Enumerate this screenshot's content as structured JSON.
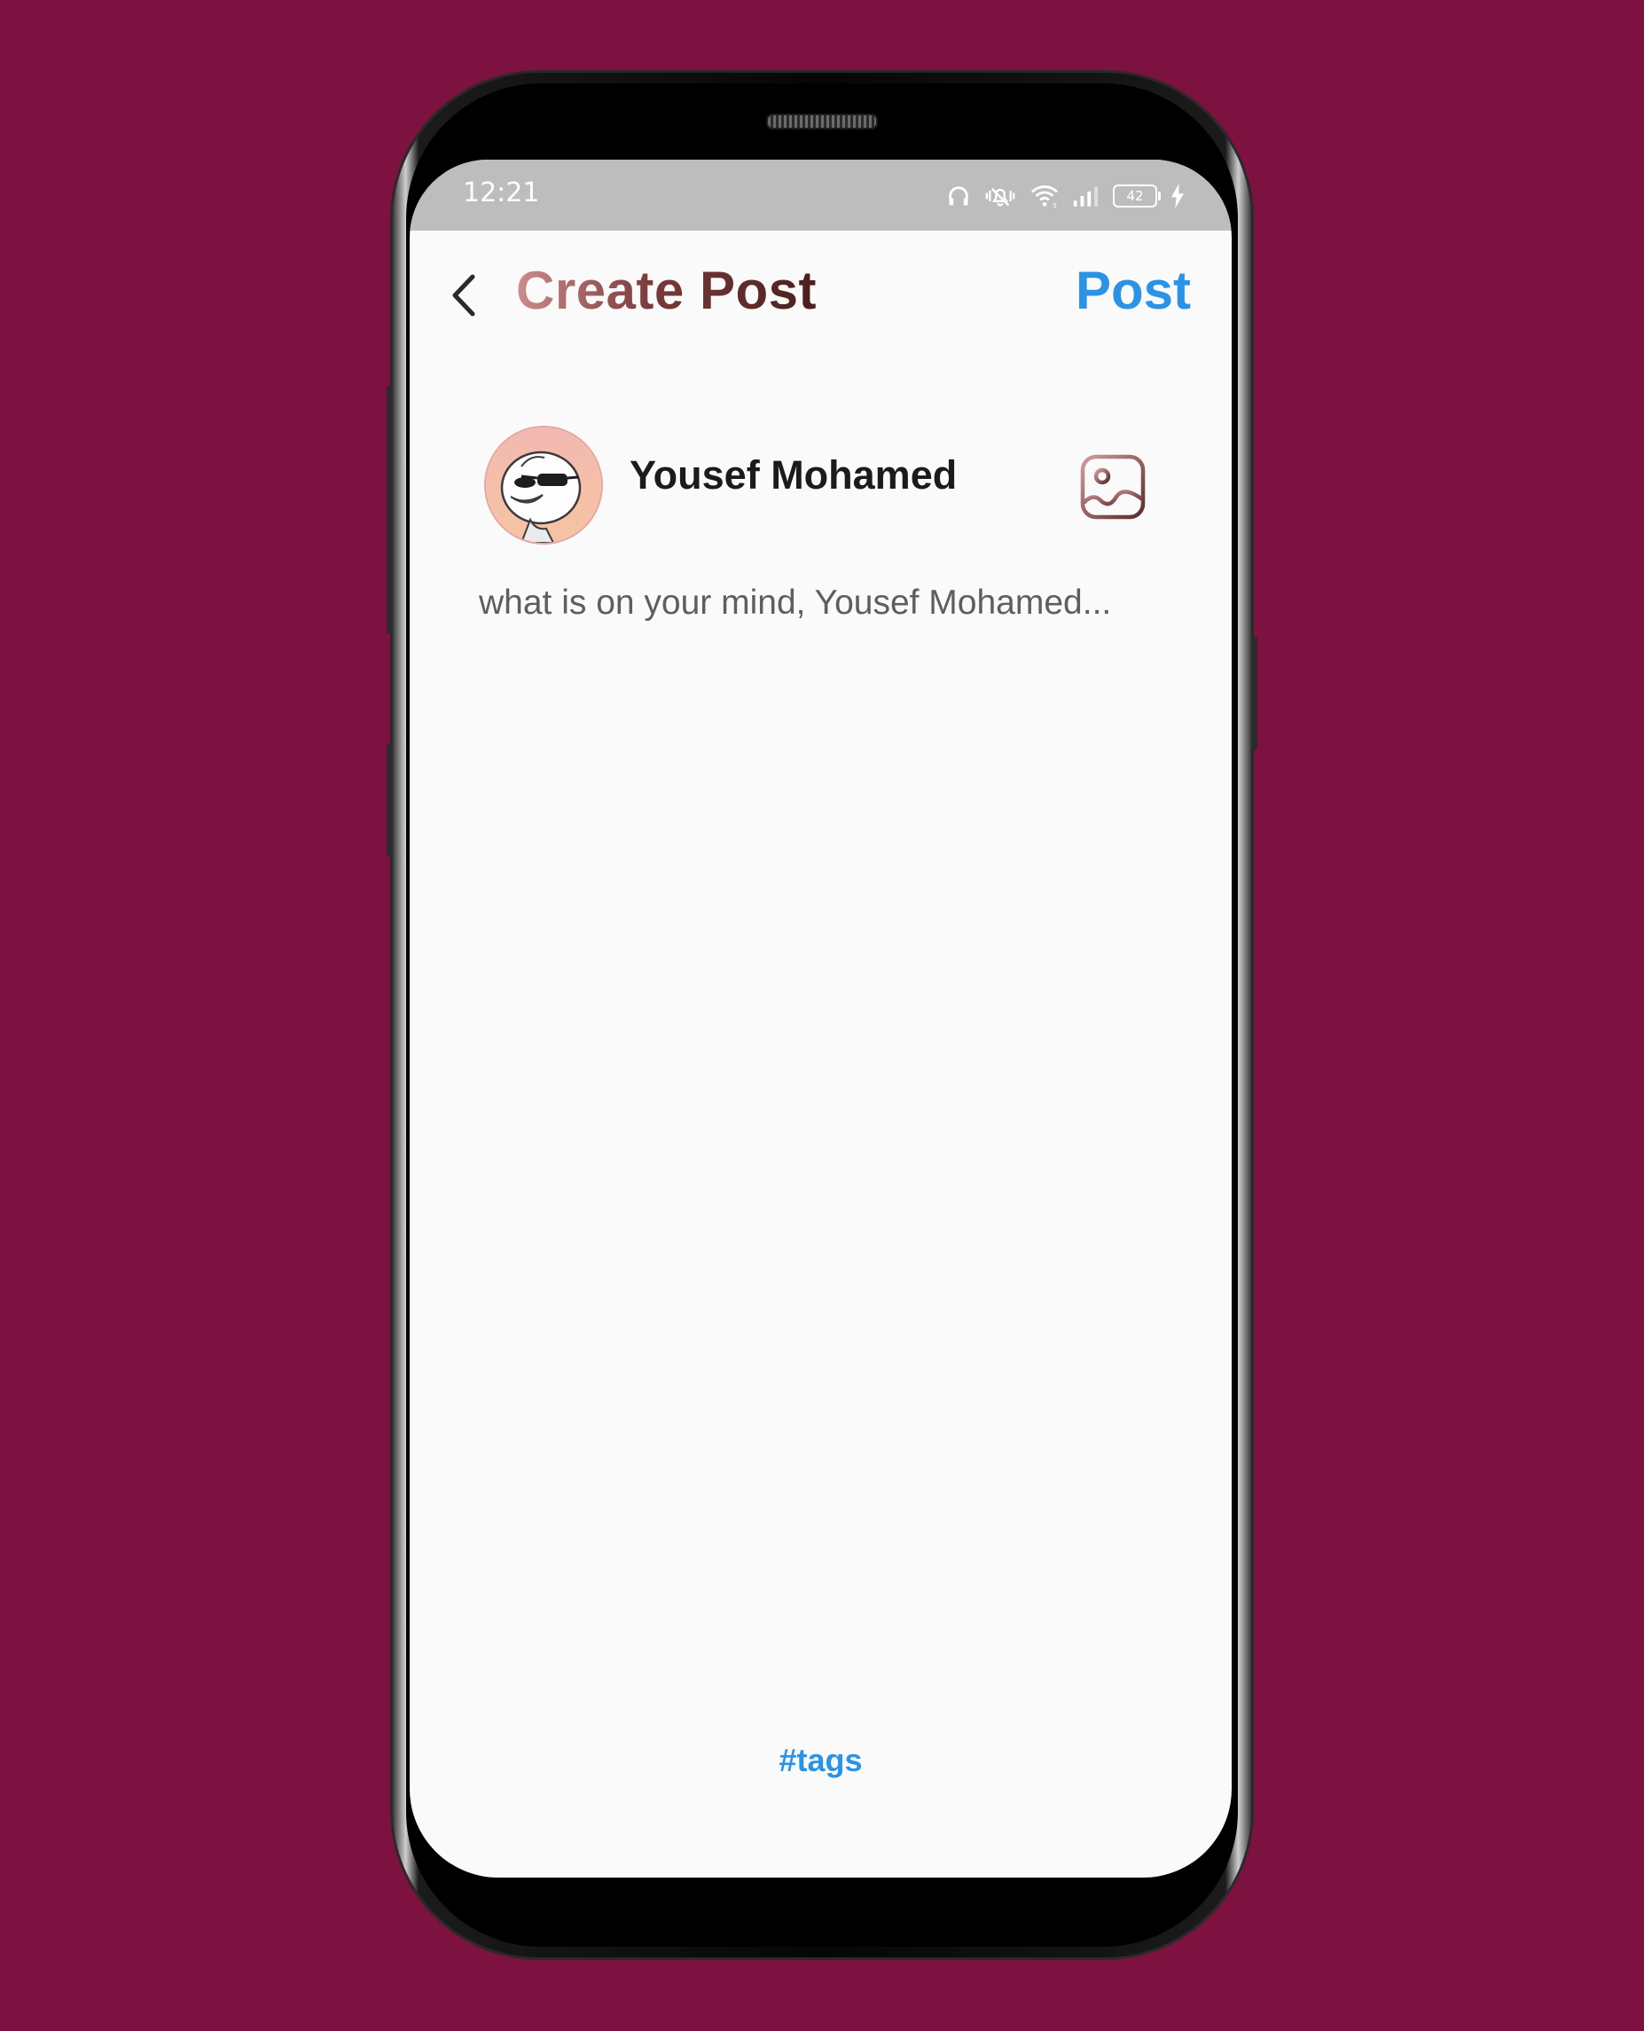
{
  "status_bar": {
    "time": "12:21",
    "battery_level": "42",
    "icons": [
      "headphones-icon",
      "vibrate-mute-icon",
      "wifi-icon",
      "signal-icon",
      "battery-icon",
      "charging-icon"
    ]
  },
  "header": {
    "title": "Create Post",
    "post_label": "Post"
  },
  "composer": {
    "user_name": "Yousef Mohamed",
    "placeholder": "what is on your mind, Yousef Mohamed...",
    "value": ""
  },
  "footer": {
    "tags_label": "#tags"
  },
  "colors": {
    "background": "#7d1140",
    "accent": "#2b93e6",
    "title_gradient_start": "#cc8c8c",
    "title_gradient_end": "#4a1f1f",
    "status_bar": "#bdbdbd"
  }
}
